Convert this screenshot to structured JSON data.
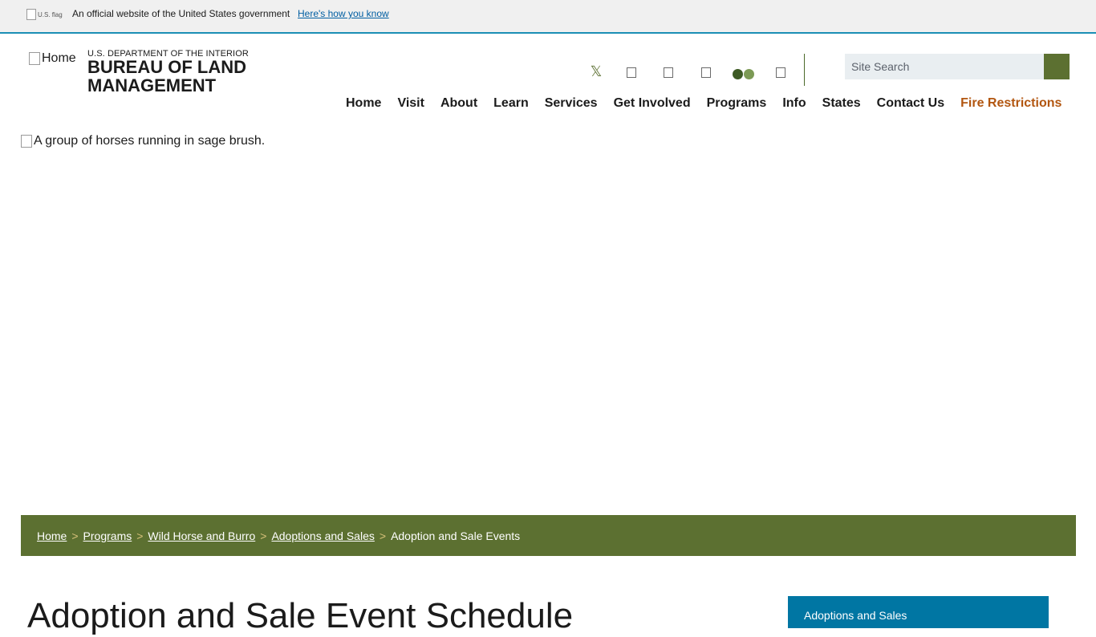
{
  "gov_banner": {
    "flag_alt": "U.S. flag",
    "official_text": "An official website of the United States government",
    "how_you_know": "Here's how you know"
  },
  "header": {
    "logo_alt": "Home",
    "department": "U.S. DEPARTMENT OF THE INTERIOR",
    "agency": "BUREAU OF LAND MANAGEMENT",
    "social_icons": [
      "x-icon",
      "facebook-icon",
      "instagram-icon",
      "youtube-icon",
      "flickr-icon",
      "linkedin-icon"
    ],
    "social_x_glyph": "𝕏",
    "search_placeholder": "Site Search"
  },
  "nav": {
    "items": [
      "Home",
      "Visit",
      "About",
      "Learn",
      "Services",
      "Get Involved",
      "Programs",
      "Info",
      "States",
      "Contact Us",
      "Fire Restrictions"
    ]
  },
  "hero": {
    "alt": "A group of horses running in sage brush."
  },
  "breadcrumb": {
    "links": [
      "Home",
      "Programs",
      "Wild Horse and Burro",
      "Adoptions and Sales"
    ],
    "separator": ">",
    "current": "Adoption and Sale Events"
  },
  "main": {
    "title": "Adoption and Sale Event Schedule"
  },
  "sidebar": {
    "title": "Adoptions and Sales"
  },
  "colors": {
    "accent_green": "#5c7031",
    "fire_orange": "#b25610",
    "sidebar_blue": "#0076a3",
    "banner_rule": "#1b8fb5"
  }
}
